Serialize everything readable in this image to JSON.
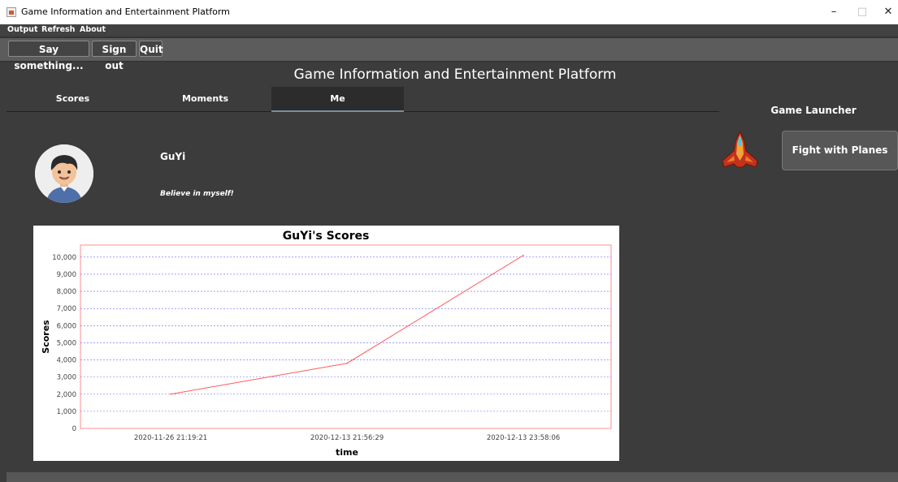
{
  "window": {
    "title": "Game Information and Entertainment Platform",
    "controls": {
      "minimize": "–",
      "maximize": "□",
      "close": "✕"
    }
  },
  "menu": {
    "items": [
      "Output",
      "Refresh",
      "About"
    ]
  },
  "toolbar": {
    "say_label": "Say something...",
    "signout_label": "Sign out",
    "quit_label": "Quit"
  },
  "header": {
    "title": "Game Information and Entertainment Platform"
  },
  "tabs": [
    {
      "label": "Scores",
      "active": false
    },
    {
      "label": "Moments",
      "active": false
    },
    {
      "label": "Me",
      "active": true
    }
  ],
  "profile": {
    "name": "GuYi",
    "motto": "Believe in myself!"
  },
  "launcher": {
    "title": "Game Launcher",
    "game_button": "Fight with Planes",
    "game_icon": "plane-icon"
  },
  "colors": {
    "background": "#3c3c3c",
    "line": "#ff5a5a",
    "gridline": "#6464ff",
    "active_tab_underline": "#7a8fa0"
  },
  "chart_data": {
    "type": "line",
    "title": "GuYi's Scores",
    "xlabel": "time",
    "ylabel": "Scores",
    "x": [
      "2020-11-26 21:19:21",
      "2020-12-13 21:56:29",
      "2020-12-13 23:58:06"
    ],
    "series": [
      {
        "values": [
          2000,
          3800,
          10100
        ]
      }
    ],
    "ylim": [
      0,
      10700
    ],
    "yticks": [
      0,
      1000,
      2000,
      3000,
      4000,
      5000,
      6000,
      7000,
      8000,
      9000,
      10000
    ],
    "ytick_labels": [
      "0",
      "1,000",
      "2,000",
      "3,000",
      "4,000",
      "5,000",
      "6,000",
      "7,000",
      "8,000",
      "9,000",
      "10,000"
    ],
    "grid": true,
    "legend": "none"
  }
}
